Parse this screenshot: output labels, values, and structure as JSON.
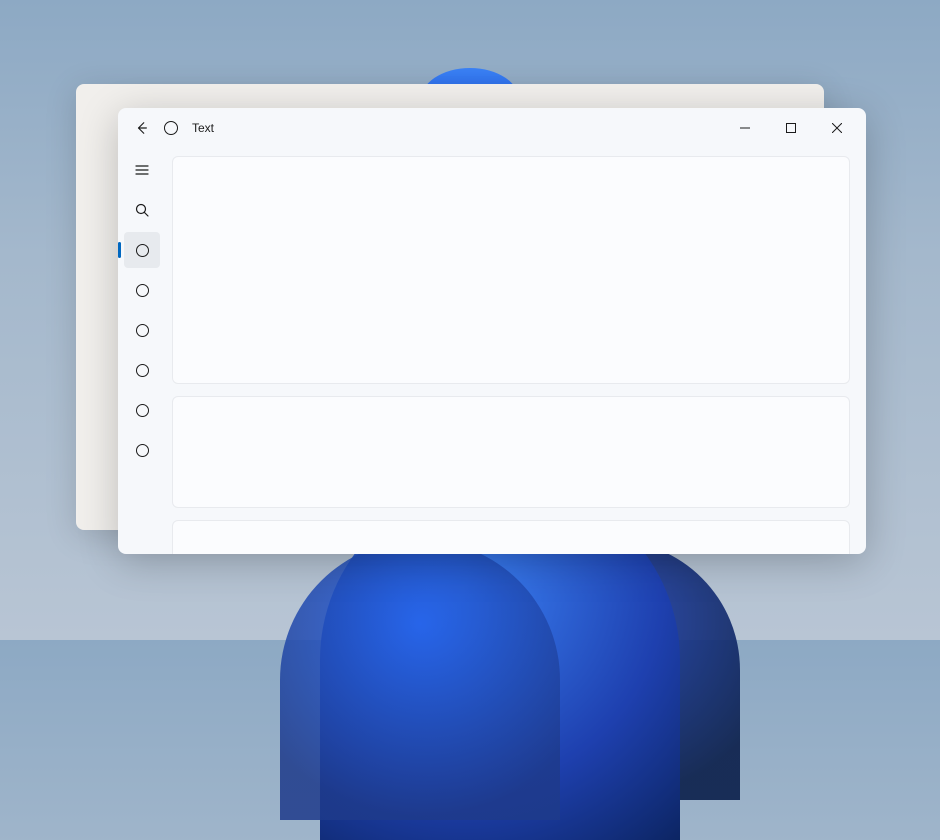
{
  "window": {
    "title": "Text"
  },
  "sidebar": {
    "items": [
      {
        "type": "hamburger",
        "name": "menu-icon"
      },
      {
        "type": "search",
        "name": "search-icon"
      },
      {
        "type": "circle",
        "name": "nav-item-1",
        "selected": true
      },
      {
        "type": "circle",
        "name": "nav-item-2"
      },
      {
        "type": "circle",
        "name": "nav-item-3"
      },
      {
        "type": "circle",
        "name": "nav-item-4"
      },
      {
        "type": "circle",
        "name": "nav-item-5"
      },
      {
        "type": "circle",
        "name": "nav-item-6"
      }
    ]
  },
  "content": {
    "cards": [
      {
        "size": "large"
      },
      {
        "size": "medium"
      },
      {
        "size": "small"
      }
    ]
  }
}
